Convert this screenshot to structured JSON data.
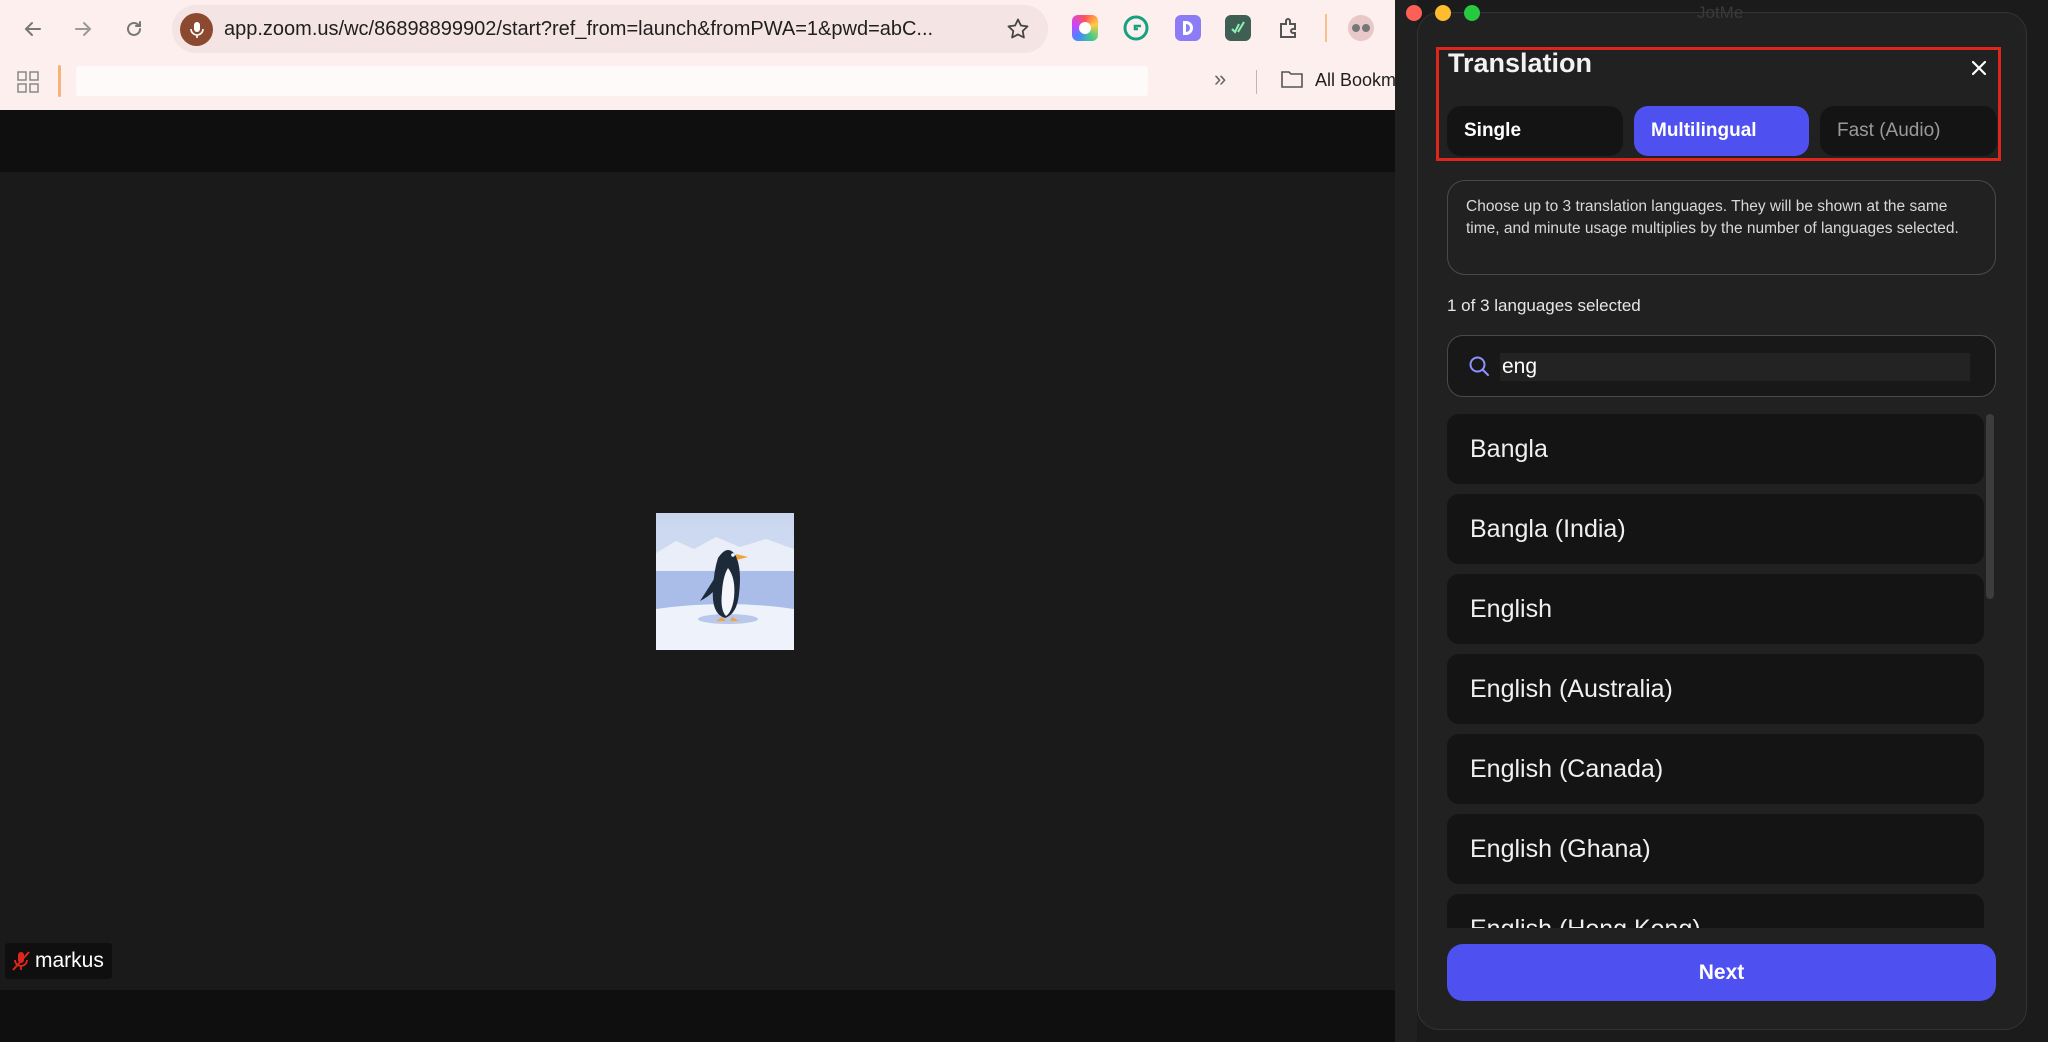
{
  "browser": {
    "url": "app.zoom.us/wc/86898899902/start?ref_from=launch&fromPWA=1&pwd=abC...",
    "bookmarks_all_label": "All Bookm",
    "extensions": [
      "color-picker-extension-icon",
      "grammarly-extension-icon",
      "d-extension-icon",
      "check-extension-icon",
      "puzzle-icon",
      "glasses-extension-icon"
    ]
  },
  "meeting": {
    "participant_name": "markus",
    "muted": true
  },
  "panel": {
    "window_title": "JotMe",
    "title": "Translation",
    "tabs": [
      {
        "label": "Single",
        "active": false
      },
      {
        "label": "Multilingual",
        "active": true
      },
      {
        "label": "Fast (Audio)",
        "active": false
      }
    ],
    "info_text": "Choose up to 3 translation languages. They will be shown at the same time, and minute usage multiplies by the number of languages selected.",
    "selection_count": "1 of 3 languages selected",
    "search": {
      "value": "eng",
      "placeholder": ""
    },
    "languages": [
      "Bangla",
      "Bangla (India)",
      "English",
      "English (Australia)",
      "English (Canada)",
      "English (Ghana)",
      "English (Hong Kong)"
    ],
    "next_label": "Next",
    "colors": {
      "accent": "#4e50f0",
      "highlight_border": "#e0261b"
    }
  }
}
